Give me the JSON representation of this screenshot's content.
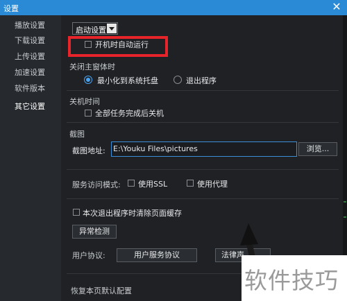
{
  "window": {
    "title": "设置",
    "close_glyph": "✕"
  },
  "sidebar": {
    "items": [
      {
        "label": "播放设置",
        "active": false
      },
      {
        "label": "下载设置",
        "active": false
      },
      {
        "label": "上传设置",
        "active": false
      },
      {
        "label": "加速设置",
        "active": false
      },
      {
        "label": "软件版本",
        "active": false
      },
      {
        "label": "其它设置",
        "active": true
      }
    ]
  },
  "main": {
    "startup": {
      "dropdown_value": "启动设置",
      "autostart_label": "开机时自动运行",
      "autostart_checked": false
    },
    "close_main": {
      "title": "关闭主窗体时",
      "minimize_label": "最小化到系统托盘",
      "exit_label": "退出程序",
      "selected": "minimize"
    },
    "shutdown": {
      "title": "关机时间",
      "all_tasks_label": "全部任务完成后关机",
      "checked": false
    },
    "screenshot": {
      "title": "截图",
      "address_label": "截图地址:",
      "path_value": "E:\\Youku Files\\pictures",
      "browse_label": "浏览..."
    },
    "service": {
      "mode_label": "服务访问模式:",
      "ssl_label": "使用SSL",
      "proxy_label": "使用代理",
      "ssl_checked": false,
      "proxy_checked": false
    },
    "cache": {
      "clear_label": "本次退出程序时清除页面缓存",
      "checked": false
    },
    "detect_button": "异常检测",
    "agreement": {
      "label": "用户协议:",
      "service_button": "用户服务协议",
      "legal_button": "法律声"
    },
    "restore_label": "恢复本页默认配置"
  },
  "watermark": {
    "text": "软件技巧"
  },
  "colors": {
    "titlebar": "#2b8ad6",
    "highlight": "#e8242b",
    "accent": "#4aa3f0"
  }
}
